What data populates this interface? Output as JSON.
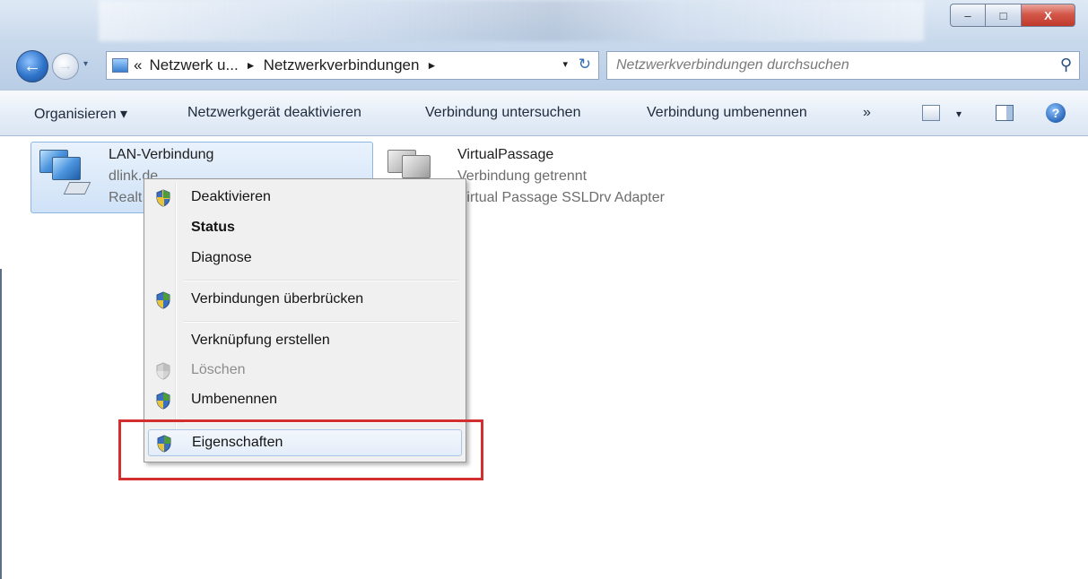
{
  "window": {
    "buttons": {
      "minimize": "–",
      "maximize": "□",
      "close": "X"
    }
  },
  "nav": {
    "back_icon": "←",
    "forward_icon": "→",
    "recent_icon": "▾"
  },
  "address": {
    "prefix": "«",
    "crumb1": "Netzwerk u...",
    "sep1": "►",
    "crumb2": "Netzwerkverbindungen",
    "sep2": "►",
    "dropdown": "▾",
    "refresh": "↻"
  },
  "search": {
    "placeholder": "Netzwerkverbindungen durchsuchen",
    "icon": "⚲"
  },
  "toolbar": {
    "organize": "Organisieren ▾",
    "disable_device": "Netzwerkgerät deaktivieren",
    "diagnose": "Verbindung untersuchen",
    "rename": "Verbindung umbenennen",
    "more": "»",
    "views_dropdown": "▾",
    "help": "?"
  },
  "connections": [
    {
      "name": "LAN-Verbindung",
      "line2": "dlink.de",
      "line3": "Realt"
    },
    {
      "name": "VirtualPassage",
      "line2": "Verbindung getrennt",
      "line3": "Virtual Passage SSLDrv Adapter"
    }
  ],
  "context_menu": {
    "items": [
      {
        "label": "Deaktivieren",
        "shield": true
      },
      {
        "label": "Status",
        "bold": true
      },
      {
        "label": "Diagnose"
      },
      {
        "label": "Verbindungen überbrücken",
        "shield": true
      },
      {
        "label": "Verknüpfung erstellen"
      },
      {
        "label": "Löschen",
        "shield": true,
        "disabled": true
      },
      {
        "label": "Umbenennen",
        "shield": true
      },
      {
        "label": "Eigenschaften",
        "shield": true,
        "highlighted": true
      }
    ]
  },
  "colors": {
    "highlight_box": "#d32f2f",
    "selection_border": "#8fb6e0",
    "menu_background": "#f0f0f0"
  }
}
